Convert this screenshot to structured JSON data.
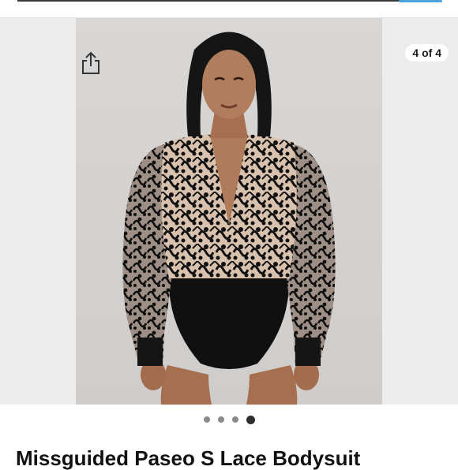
{
  "gallery": {
    "counter": "4 of 4",
    "dots": [
      false,
      false,
      false,
      true
    ],
    "image_icon": "product-photo-lace-bodysuit"
  },
  "toolbar": {
    "share_icon": "share-icon"
  },
  "product": {
    "title": "Missguided Paseo S Lace Bodysuit"
  },
  "colors": {
    "accent": "#4aa3df",
    "dot_active": "#2e2e2e",
    "dot_inactive": "#8a8a8a"
  }
}
